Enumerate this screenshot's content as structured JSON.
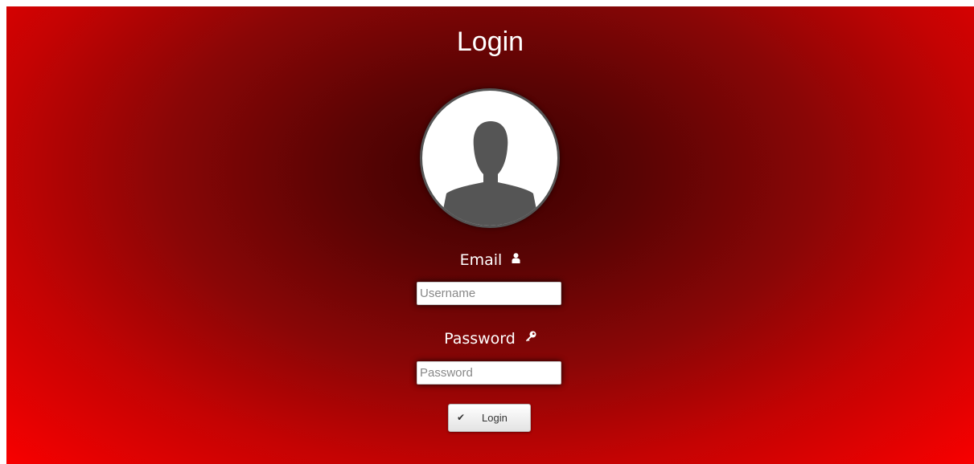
{
  "page": {
    "title": "Login"
  },
  "avatar": {
    "icon": "user-silhouette-icon"
  },
  "email": {
    "label": "Email",
    "icon": "user-icon",
    "placeholder": "Username",
    "value": ""
  },
  "password": {
    "label": "Password",
    "icon": "key-icon",
    "placeholder": "Password",
    "value": ""
  },
  "login_button": {
    "label": "Login",
    "icon": "checkmark-icon",
    "check_glyph": "✔"
  },
  "colors": {
    "background_center": "#3a0000",
    "background_edge": "#f80000",
    "avatar_silhouette": "#555555",
    "text": "#ffffff"
  }
}
